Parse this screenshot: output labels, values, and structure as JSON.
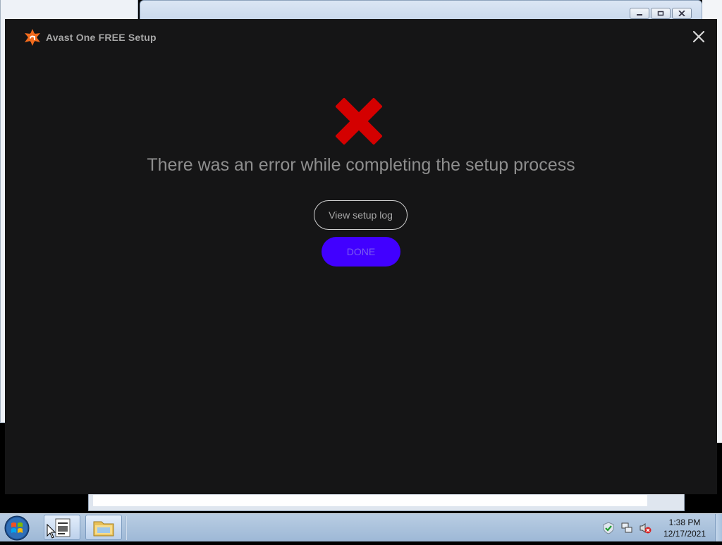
{
  "installer": {
    "title": "Avast One FREE Setup",
    "error_message": "There was an error while completing the setup process",
    "view_log_label": "View setup log",
    "done_label": "DONE",
    "close_icon": "close-icon",
    "error_icon": "error-x-icon",
    "colors": {
      "background": "#151516",
      "done_button": "#4100ff",
      "error_icon": "#d40000",
      "logo": "#f26b1d"
    }
  },
  "taskbar": {
    "start_icon": "windows-start-orb-icon",
    "pinned": [
      {
        "name": "document-app-icon"
      },
      {
        "name": "file-explorer-icon"
      }
    ],
    "tray_icons": [
      "security-shield-icon",
      "network-icon",
      "volume-muted-icon"
    ],
    "time": "1:38 PM",
    "date": "12/17/2021"
  }
}
